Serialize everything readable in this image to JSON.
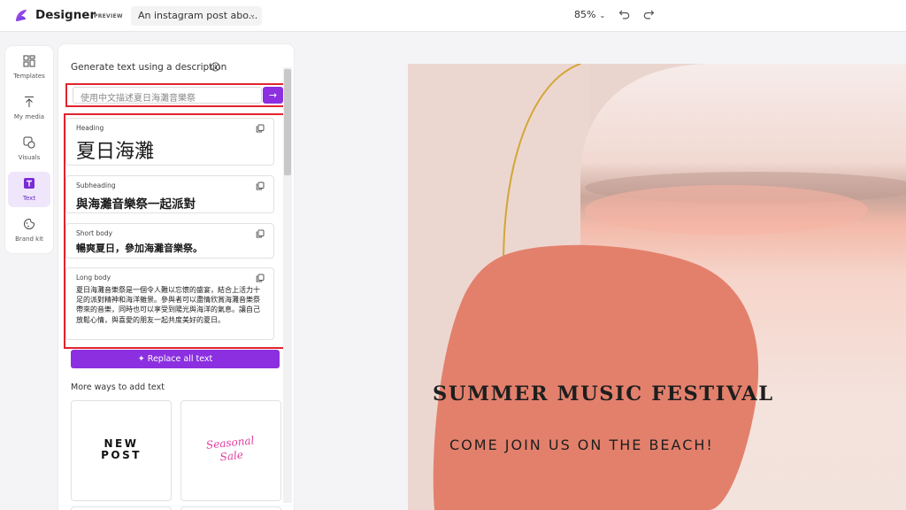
{
  "app": {
    "name": "Designer",
    "badge": "PREVIEW"
  },
  "header": {
    "doc_title": "An instagram post abo...",
    "zoom": "85%"
  },
  "rail": {
    "items": [
      {
        "label": "Templates"
      },
      {
        "label": "My media"
      },
      {
        "label": "Visuals"
      },
      {
        "label": "Text"
      },
      {
        "label": "Brand kit"
      }
    ]
  },
  "panel": {
    "title": "Generate text using a description",
    "prompt_value": "使用中文描述夏日海灘音樂祭",
    "results": {
      "heading": {
        "type": "Heading",
        "text": "夏日海灘"
      },
      "subheading": {
        "type": "Subheading",
        "text": "與海灘音樂祭一起派對"
      },
      "short": {
        "type": "Short body",
        "text": "暢爽夏日，參加海灘音樂祭。"
      },
      "long": {
        "type": "Long body",
        "text": "夏日海灘音樂祭是一個令人難以忘懷的盛宴，結合上活力十足的派對精神和海洋雜景。參與者可以盡情欣賞海灘音樂祭帶來的音樂，同時也可以享受到陽光與海洋的氣息。讓自己放鬆心情，與喜愛的朋友一起共度美好的夏日。"
      }
    },
    "replace_label": "Replace all text",
    "more_title": "More ways to add text",
    "tiles": [
      {
        "line1": "NEW",
        "line2": "POST"
      },
      {
        "line1": "Seasonal",
        "line2": "Sale"
      }
    ]
  },
  "design": {
    "title": "SUMMER MUSIC FESTIVAL",
    "subtitle": "COME JOIN US ON THE BEACH!"
  },
  "colors": {
    "accent": "#8b2fe0",
    "highlight": "#e2242f",
    "blob": "#e3806c",
    "arch": "#d4a63a"
  }
}
